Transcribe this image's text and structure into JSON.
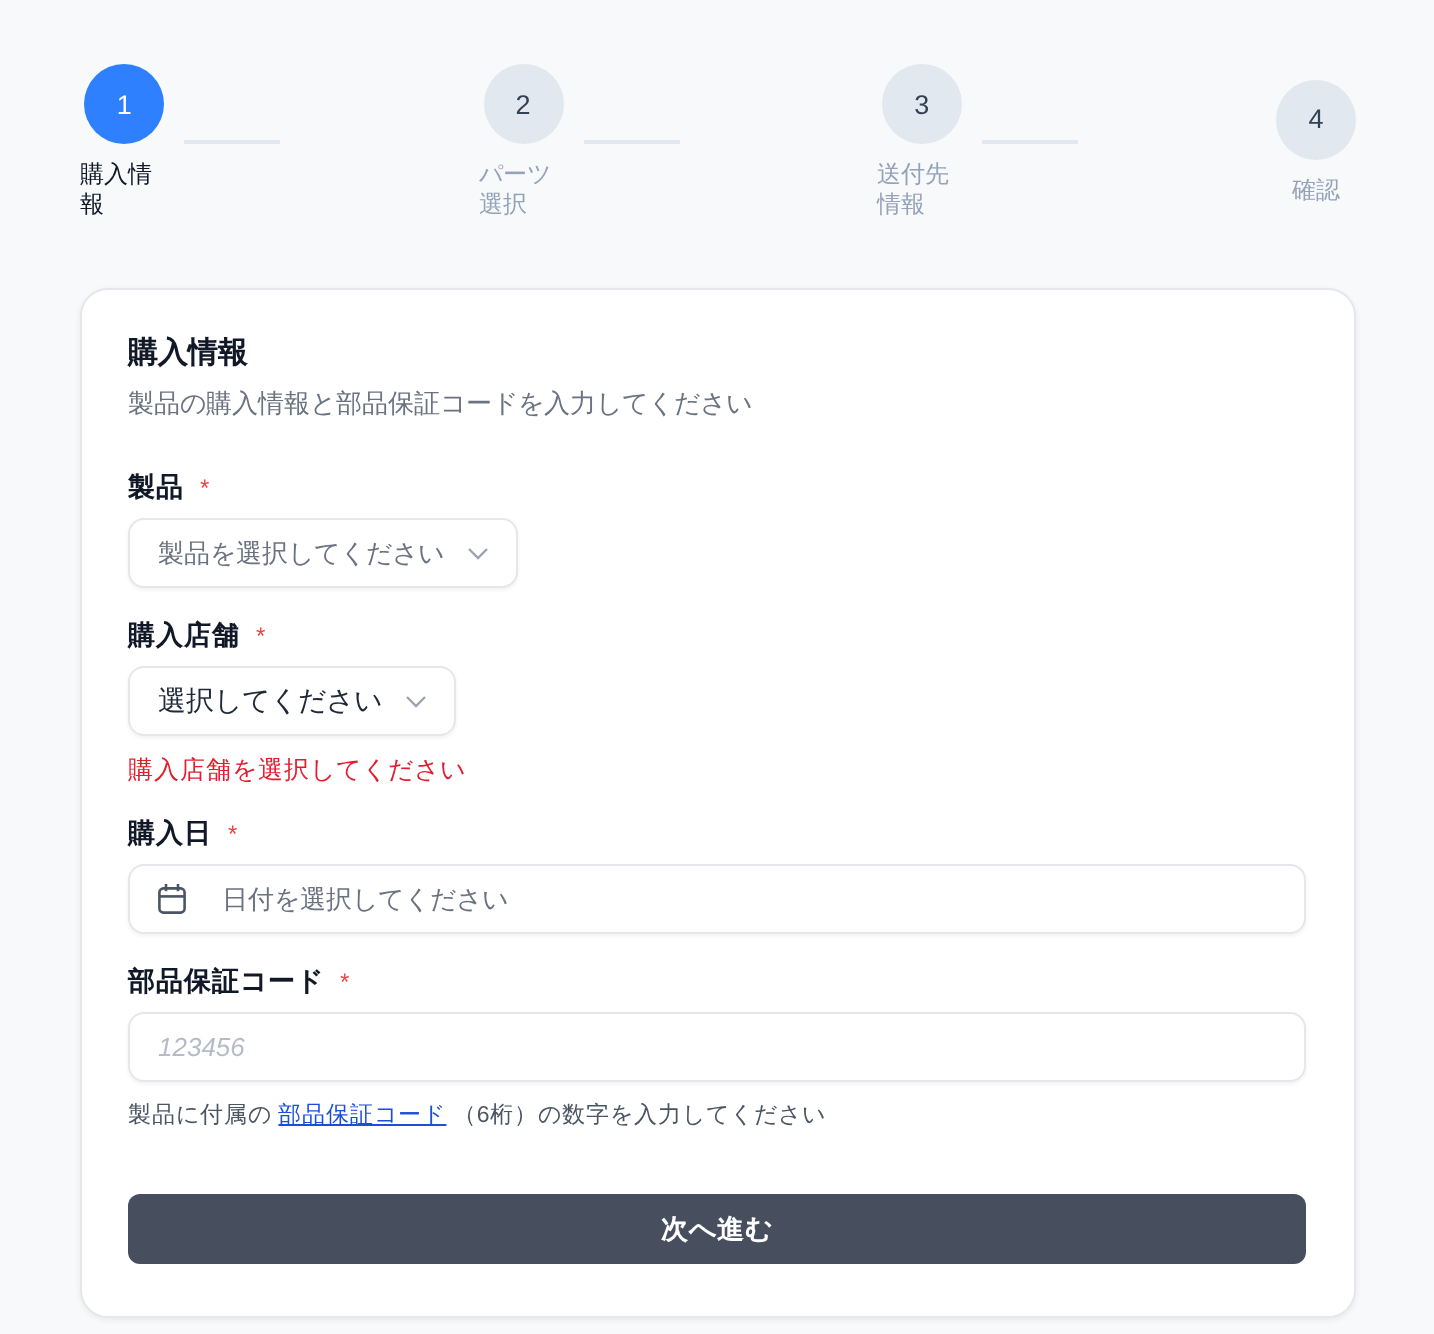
{
  "stepper": {
    "steps": [
      {
        "number": "1",
        "label": "購入情報",
        "selected": true
      },
      {
        "number": "2",
        "label": "パーツ選択",
        "selected": false
      },
      {
        "number": "3",
        "label": "送付先情報",
        "selected": false
      },
      {
        "number": "4",
        "label": "確認",
        "selected": false
      }
    ]
  },
  "form": {
    "title": "購入情報",
    "subtitle": "製品の購入情報と部品保証コードを入力してください",
    "fields": [
      {
        "kind": "select",
        "label": "製品",
        "required_mark": "*",
        "placeholder": "製品を選択してください"
      },
      {
        "kind": "select",
        "label": "購入店舗",
        "required_mark": "*",
        "value": "選択してください",
        "error": "購入店舗を選択してください"
      },
      {
        "kind": "date",
        "label": "購入日",
        "required_mark": "*",
        "placeholder": "日付を選択してください"
      },
      {
        "kind": "text",
        "label": "部品保証コード",
        "required_mark": "*",
        "placeholder": "123456",
        "help": {
          "before": "製品に付属の",
          "link": "部品保証コード",
          "after": "（6桁）の数字を入力してください"
        }
      }
    ],
    "submit": "次へ進む"
  }
}
